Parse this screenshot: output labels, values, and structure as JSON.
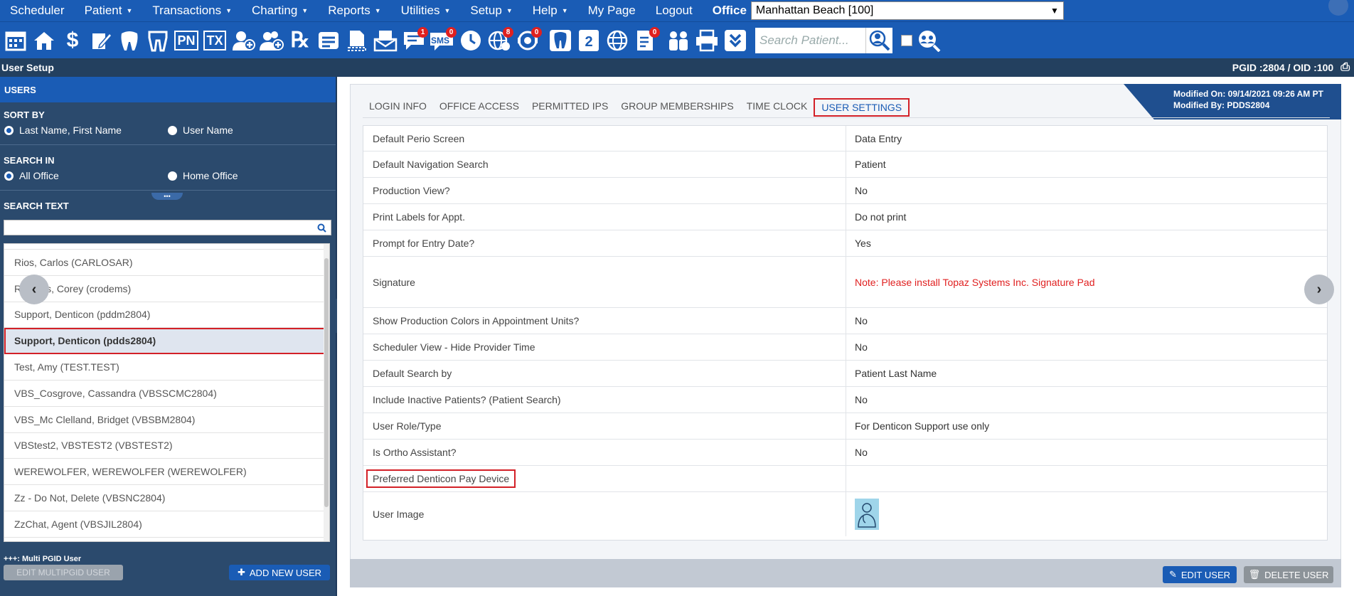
{
  "menu": {
    "items": [
      "Scheduler",
      "Patient",
      "Transactions",
      "Charting",
      "Reports",
      "Utilities",
      "Setup",
      "Help",
      "My Page",
      "Logout"
    ],
    "office_label": "Office",
    "office_value": "Manhattan Beach [100]"
  },
  "toolbar": {
    "badges": {
      "messages": "1",
      "sms": "0",
      "world": "8",
      "support": "0",
      "doc": "0"
    },
    "pn": "PN",
    "tx": "TX",
    "sms_label": "SMS",
    "search_placeholder": "Search Patient..."
  },
  "title": {
    "page": "User Setup",
    "ids": "PGID :2804  /  OID :100"
  },
  "sidebar": {
    "header": "USERS",
    "sort_by": "SORT BY",
    "sort_opt1": "Last Name, First Name",
    "sort_opt2": "User Name",
    "search_in": "SEARCH IN",
    "search_opt1": "All Office",
    "search_opt2": "Home Office",
    "search_text": "SEARCH TEXT",
    "users": [
      "Rios, Carlos (CARLOSAR)",
      "Rodems, Corey (crodems)",
      "Support, Denticon (pddm2804)",
      "Support, Denticon (pdds2804)",
      "Test, Amy (TEST.TEST)",
      "VBS_Cosgrove, Cassandra (VBSSCMC2804)",
      "VBS_Mc Clelland, Bridget (VBSBM2804)",
      "VBStest2, VBSTEST2 (VBSTEST2)",
      "WEREWOLFER, WEREWOLFER (WEREWOLFER)",
      "Zz - Do Not, Delete (VBSNC2804)",
      "ZzChat, Agent (VBSJIL2804)"
    ],
    "multi_note": "+++: Multi PGID User",
    "edit_multi": "EDIT MULTIPGID USER",
    "add_user": "ADD NEW USER"
  },
  "main": {
    "modified_on": "Modified On: 09/14/2021 09:26 AM PT",
    "modified_by": "Modified By: PDDS2804",
    "tabs": [
      "LOGIN INFO",
      "OFFICE ACCESS",
      "PERMITTED IPS",
      "GROUP MEMBERSHIPS",
      "TIME CLOCK",
      "USER SETTINGS"
    ],
    "settings": [
      {
        "label": "Default Perio Screen",
        "value": "Data Entry"
      },
      {
        "label": "Default Navigation Search",
        "value": "Patient"
      },
      {
        "label": "Production View?",
        "value": "No"
      },
      {
        "label": "Print Labels for Appt.",
        "value": "Do not print"
      },
      {
        "label": "Prompt for Entry Date?",
        "value": "Yes"
      },
      {
        "label": "Signature",
        "value": "Note: Please install Topaz Systems Inc. Signature Pad"
      },
      {
        "label": "Show Production Colors in Appointment Units?",
        "value": "No"
      },
      {
        "label": "Scheduler View - Hide Provider Time",
        "value": "No"
      },
      {
        "label": "Default Search by",
        "value": "Patient Last Name"
      },
      {
        "label": "Include Inactive Patients? (Patient Search)",
        "value": "No"
      },
      {
        "label": "User Role/Type",
        "value": "For Denticon Support use only"
      },
      {
        "label": "Is Ortho Assistant?",
        "value": "No"
      },
      {
        "label": "Preferred Denticon Pay Device",
        "value": ""
      },
      {
        "label": "User Image",
        "value": ""
      }
    ],
    "edit_user": "EDIT USER",
    "delete_user": "DELETE USER"
  }
}
